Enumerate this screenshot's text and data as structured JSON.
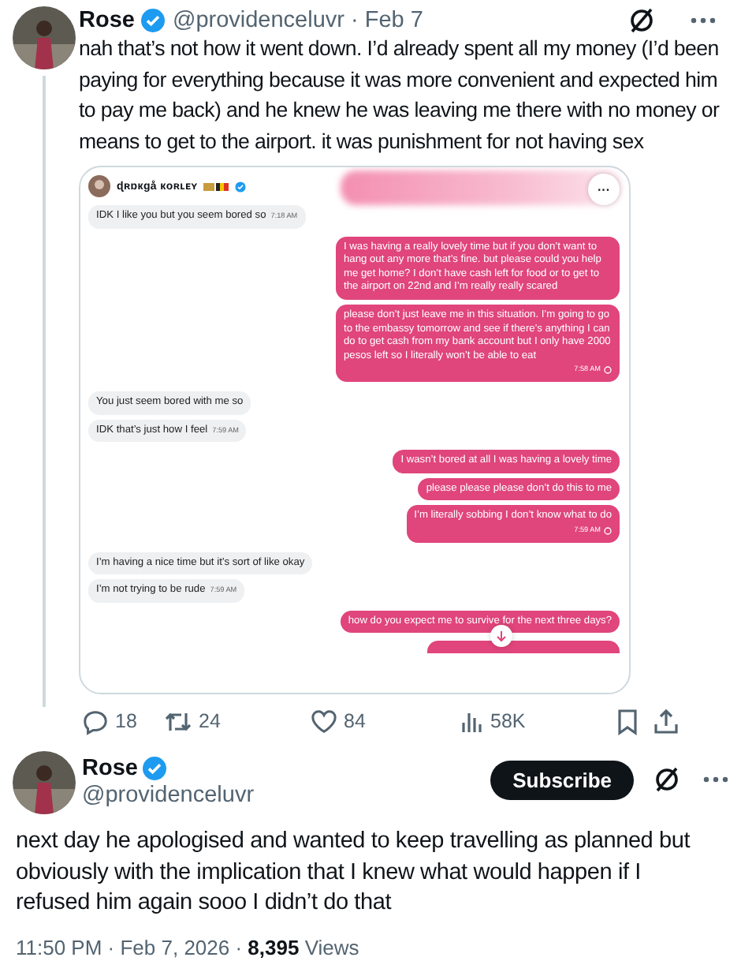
{
  "tweet": {
    "name": "Rose",
    "verified": true,
    "handle": "@providenceluvr",
    "date": "· Feb 7",
    "text": "nah that’s not how it went down. I’d already spent all my money (I’d been paying for everything because it was more convenient and expected him to pay me back) and he knew he was leaving me there with no money or means to get to the airport. it was punishment for not having sex",
    "image": {
      "contact": "ɖʀɒкgå кoʀʟᴇʏ",
      "contact_verified": true,
      "more": "···",
      "messages": [
        {
          "kind": "received",
          "text": "IDK I like you but you seem bored so",
          "time": "7:18 AM"
        },
        {
          "kind": "sent",
          "text": "I was having a really lovely time but if you don’t want to hang out any more that’s fine. but please could you help me get home? I don’t have cash left for food or to get to the airport on 22nd and I’m really really scared"
        },
        {
          "kind": "sent",
          "text": "please don’t just leave me in this situation. I’m going to go to the embassy tomorrow and see if there’s anything I can do to get cash from my bank account but I only have 2000 pesos left so I literally won’t be able to eat",
          "time": "7:58 AM"
        },
        {
          "kind": "received",
          "text": "You just seem bored with me so"
        },
        {
          "kind": "received",
          "text": "IDK that’s just how I feel",
          "time": "7:59 AM"
        },
        {
          "kind": "sent",
          "text": "I wasn’t bored at all I was having a lovely time"
        },
        {
          "kind": "sent",
          "text": "please please please don’t do this to me"
        },
        {
          "kind": "sent",
          "text": "I’m literally sobbing I don’t know what to do",
          "time": "7:59 AM"
        },
        {
          "kind": "received",
          "text": "I’m having a nice time but it’s sort of like okay"
        },
        {
          "kind": "received",
          "text": "I’m not trying to be rude",
          "time": "7:59 AM"
        },
        {
          "kind": "sent",
          "text": "how do you expect me to survive for the next three days?"
        }
      ]
    },
    "actions": [
      {
        "kind": "reply",
        "count": "18"
      },
      {
        "kind": "retweet",
        "count": "24"
      },
      {
        "kind": "like",
        "count": "84"
      },
      {
        "kind": "views",
        "count": "58K"
      },
      {
        "kind": "bookmark"
      },
      {
        "kind": "share"
      }
    ]
  },
  "reply": {
    "name": "Rose",
    "verified": true,
    "handle": "@providenceluvr",
    "subscribe": "Subscribe",
    "text": "next day he apologised and wanted to keep travelling as planned but obviously with the implication that I knew what would happen if I refused him again sooo I didn’t do that",
    "time": "11:50 PM · Feb 7, 2026 · ",
    "views_count": "8,395",
    "views_label": "Views"
  }
}
